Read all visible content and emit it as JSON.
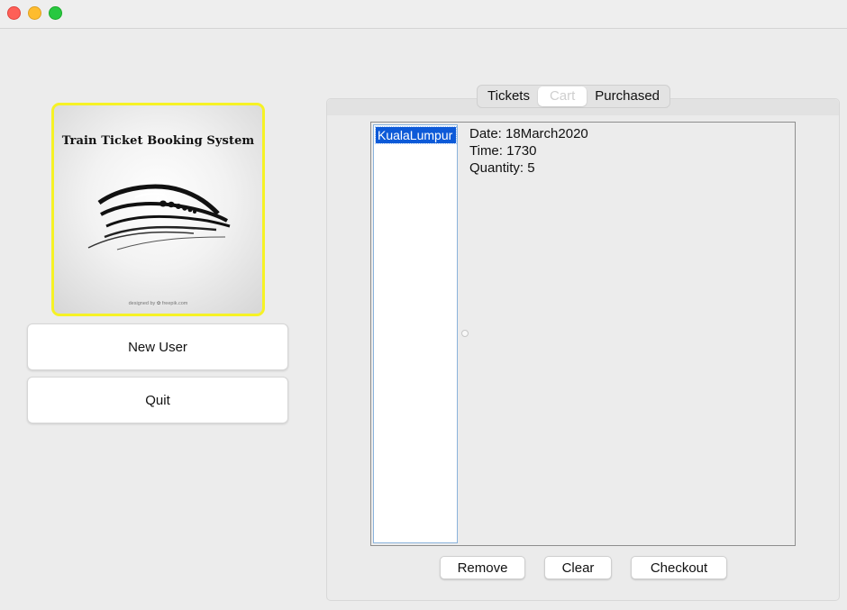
{
  "window": {
    "controls": [
      "close",
      "minimize",
      "zoom"
    ]
  },
  "logo": {
    "title": "Train Ticket Booking System",
    "credit": "designed by ✿ freepik.com",
    "border_color": "#f6f225",
    "icon": "train-logo"
  },
  "sidebar": {
    "new_user_label": "New User",
    "quit_label": "Quit"
  },
  "tabs": [
    {
      "label": "Tickets",
      "active": false
    },
    {
      "label": "Cart",
      "active": true
    },
    {
      "label": "Purchased",
      "active": false
    }
  ],
  "cart": {
    "list_items": [
      "KualaLumpur"
    ],
    "selected_index": 0,
    "details": {
      "date": "Date: 18March2020",
      "time": "Time: 1730",
      "quantity": "Quantity: 5"
    }
  },
  "actions": {
    "remove_label": "Remove",
    "clear_label": "Clear",
    "checkout_label": "Checkout"
  },
  "colors": {
    "selection": "#0d5ad8",
    "window_bg": "#ececec"
  }
}
